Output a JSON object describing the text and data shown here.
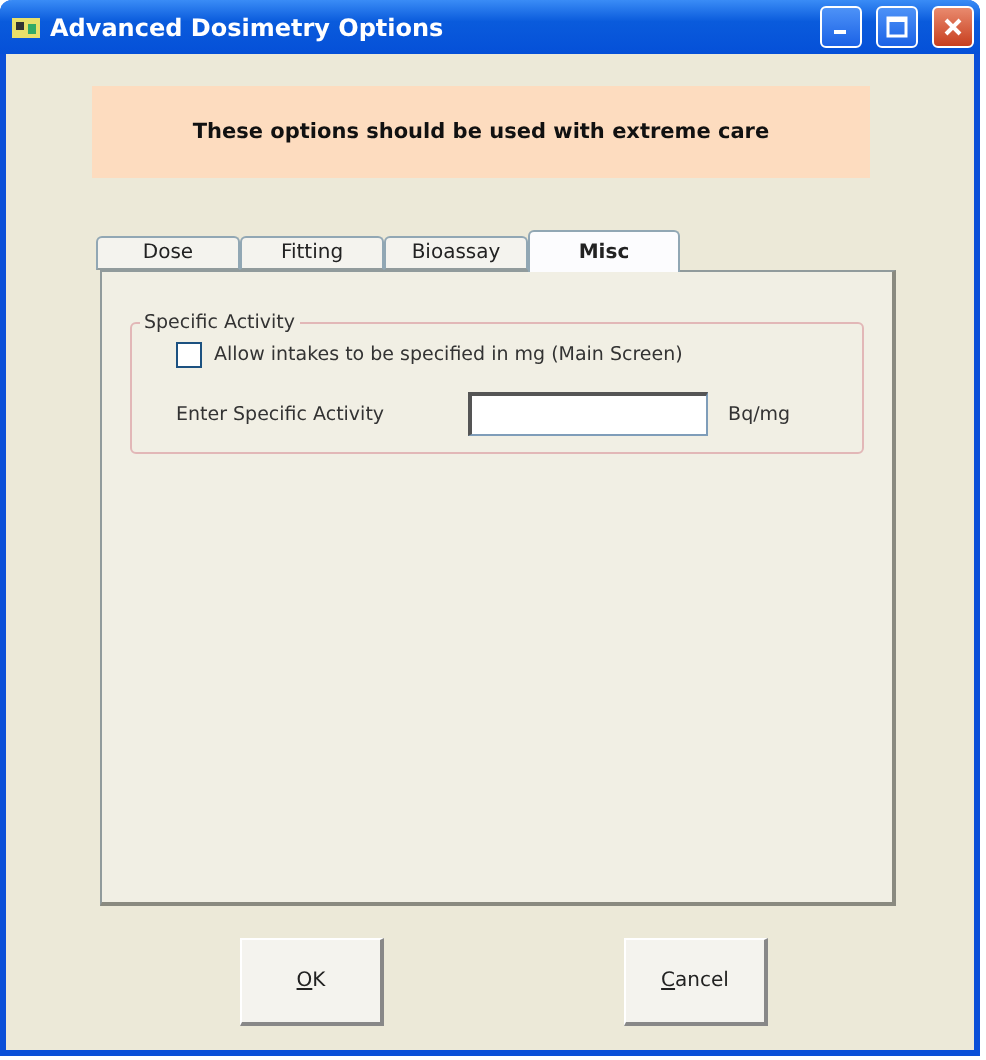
{
  "window": {
    "title": "Advanced Dosimetry Options"
  },
  "warning": "These options should be used with extreme care",
  "tabs": [
    {
      "label": "Dose",
      "selected": false
    },
    {
      "label": "Fitting",
      "selected": false
    },
    {
      "label": "Bioassay",
      "selected": false
    },
    {
      "label": "Misc",
      "selected": true
    }
  ],
  "group": {
    "title": "Specific Activity",
    "checkbox": {
      "label": "Allow intakes to be specified in mg (Main Screen)",
      "checked": false
    },
    "field": {
      "label": "Enter Specific Activity",
      "unit": "Bq/mg"
    }
  },
  "buttons": [
    {
      "label": "OK",
      "access_key_underlined": true
    },
    {
      "label": "Cancel",
      "access_key_underlined": true
    }
  ]
}
